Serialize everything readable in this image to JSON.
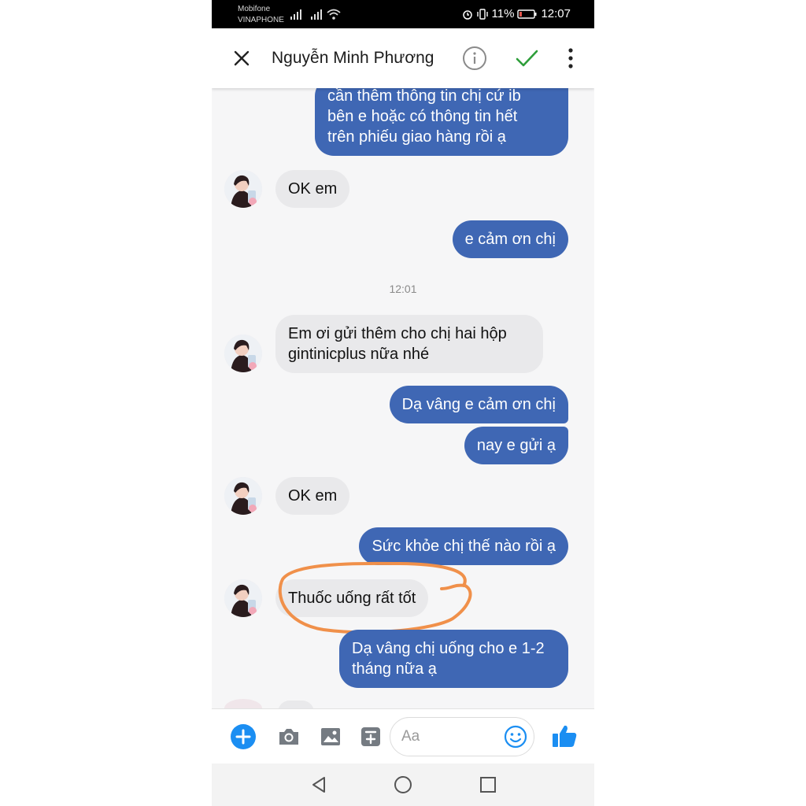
{
  "status_bar": {
    "carrier_1": "Mobifone",
    "carrier_2": "VINAPHONE",
    "battery": "11%",
    "time": "12:07"
  },
  "header": {
    "contact_name": "Nguyễn Minh Phương",
    "icons": [
      "close-icon",
      "info-icon",
      "check-icon",
      "more-vertical-icon"
    ]
  },
  "messages": [
    {
      "side": "out",
      "lines": [
        "cần thêm thông tin chị cứ ib",
        "bên e hoặc có thông tin hết",
        "trên phiếu giao hàng rồi ạ"
      ]
    },
    {
      "side": "in",
      "lines": [
        "OK em"
      ]
    },
    {
      "side": "out",
      "lines": [
        "e cảm ơn chị"
      ]
    },
    {
      "timestamp": "12:01"
    },
    {
      "side": "in",
      "lines": [
        "Em ơi gửi thêm cho chị hai hộp",
        "gintinicplus nữa nhé"
      ]
    },
    {
      "side": "out",
      "lines": [
        "Dạ vâng e cảm ơn chị"
      ]
    },
    {
      "side": "out",
      "lines": [
        "nay e gửi ạ"
      ]
    },
    {
      "side": "in",
      "lines": [
        "OK em"
      ]
    },
    {
      "side": "out",
      "lines": [
        "Sức khỏe chị thế nào rồi ạ"
      ]
    },
    {
      "side": "in",
      "lines": [
        "Thuốc uống rất tốt"
      ],
      "highlighted": true
    },
    {
      "side": "out",
      "lines": [
        "Dạ vâng chị uống cho e 1-2",
        "tháng nữa ạ"
      ]
    }
  ],
  "composer": {
    "placeholder": "Aa",
    "icons": [
      "add-icon",
      "camera-icon",
      "image-icon",
      "sticker-icon",
      "emoji-icon",
      "like-icon"
    ]
  },
  "colors": {
    "outgoing_bubble": "#3f67b4",
    "incoming_bubble": "#e9e9eb",
    "accent_blue": "#1b8ef2",
    "check_green": "#2e9e3a",
    "highlight_orange": "#f0904a"
  }
}
